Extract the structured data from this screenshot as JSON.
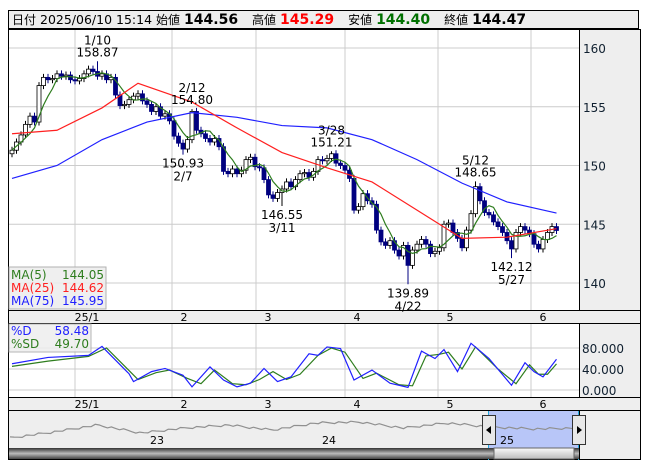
{
  "header": {
    "date_label": "日付",
    "datetime": "2025/06/10 15:14",
    "open_label": "始値",
    "open": "144.56",
    "high_label": "高値",
    "high": "145.29",
    "low_label": "安値",
    "low": "144.40",
    "close_label": "終値",
    "close": "144.47"
  },
  "colors": {
    "up_body": "#ffffff",
    "down_body": "#000080",
    "ma5": "#2e7d1e",
    "ma25": "#ff2020",
    "ma75": "#2020ff",
    "stoch_d": "#2020ff",
    "stoch_sd": "#2e7d1e",
    "high_text": "#ff0000",
    "low_text": "#007000",
    "selection": "#b8c6f8"
  },
  "chart_data": [
    {
      "type": "candlestick",
      "yticks": [
        "160",
        "155",
        "150",
        "145",
        "140"
      ],
      "ylim": [
        138,
        162
      ],
      "month_labels": [
        "25/1",
        "2",
        "3",
        "4",
        "5",
        "6"
      ],
      "first_open": 151.0,
      "close": [
        151.3,
        152.0,
        152.6,
        153.5,
        154.2,
        153.7,
        156.8,
        157.5,
        157.3,
        157.4,
        157.8,
        157.6,
        157.7,
        157.3,
        157.2,
        157.4,
        157.8,
        158.2,
        158.0,
        157.6,
        157.8,
        157.3,
        157.5,
        156.0,
        155.1,
        155.2,
        155.6,
        155.9,
        156.1,
        155.5,
        155.2,
        154.6,
        155.0,
        154.2,
        154.4,
        153.8,
        152.5,
        151.9,
        151.4,
        152.2,
        154.6,
        153.0,
        152.7,
        152.3,
        152.0,
        152.3,
        151.6,
        149.5,
        149.3,
        149.7,
        149.3,
        149.6,
        150.5,
        150.7,
        149.9,
        149.8,
        148.8,
        147.5,
        147.2,
        147.7,
        148.0,
        148.6,
        148.2,
        148.8,
        149.3,
        149.4,
        149.0,
        149.5,
        150.5,
        150.4,
        150.6,
        151.0,
        150.2,
        150.0,
        149.6,
        148.9,
        146.2,
        146.5,
        147.6,
        147.0,
        146.7,
        144.5,
        143.5,
        143.2,
        143.6,
        142.8,
        142.3,
        143.2,
        141.5,
        142.8,
        143.3,
        143.7,
        143.3,
        142.5,
        142.7,
        143.0,
        145.0,
        145.1,
        144.3,
        143.8,
        143.0,
        144.5,
        145.9,
        148.2,
        147.0,
        146.0,
        145.8,
        145.2,
        144.8,
        144.3,
        143.6,
        142.9,
        144.3,
        144.8,
        144.5,
        144.2,
        143.3,
        142.9,
        143.7,
        144.3,
        144.8,
        144.47
      ],
      "annotations": [
        {
          "date": "1/10",
          "value": "158.87",
          "index": 19,
          "position": "above"
        },
        {
          "date": "2/12",
          "value": "154.80",
          "index": 40,
          "position": "above"
        },
        {
          "date": "2/7",
          "value": "150.93",
          "index": 38,
          "position": "below"
        },
        {
          "date": "3/11",
          "value": "146.55",
          "index": 60,
          "position": "below"
        },
        {
          "date": "3/28",
          "value": "151.21",
          "index": 71,
          "position": "above"
        },
        {
          "date": "4/22",
          "value": "139.89",
          "index": 88,
          "position": "below"
        },
        {
          "date": "5/12",
          "value": "148.65",
          "index": 103,
          "position": "above"
        },
        {
          "date": "5/27",
          "value": "142.12",
          "index": 111,
          "position": "below"
        }
      ],
      "ma25": [
        [
          0,
          152.7
        ],
        [
          10,
          153.0
        ],
        [
          20,
          154.9
        ],
        [
          28,
          157.0
        ],
        [
          40,
          155.4
        ],
        [
          50,
          153.2
        ],
        [
          60,
          151.1
        ],
        [
          70,
          149.8
        ],
        [
          80,
          148.6
        ],
        [
          90,
          146.2
        ],
        [
          100,
          143.8
        ],
        [
          110,
          143.9
        ],
        [
          121,
          144.62
        ]
      ],
      "ma75": [
        [
          0,
          148.9
        ],
        [
          10,
          150.0
        ],
        [
          20,
          152.2
        ],
        [
          30,
          153.7
        ],
        [
          40,
          154.5
        ],
        [
          50,
          154.1
        ],
        [
          60,
          153.4
        ],
        [
          70,
          153.2
        ],
        [
          80,
          152.2
        ],
        [
          90,
          150.5
        ],
        [
          100,
          148.5
        ],
        [
          110,
          146.9
        ],
        [
          121,
          145.95
        ]
      ],
      "legend": [
        {
          "name": "MA(5)",
          "value": "144.05"
        },
        {
          "name": "MA(25)",
          "value": "144.62"
        },
        {
          "name": "MA(75)",
          "value": "145.95"
        }
      ]
    },
    {
      "type": "line",
      "yticks": [
        "80.000",
        "40.000",
        "0.000"
      ],
      "ylim": [
        0,
        100
      ],
      "legend": [
        {
          "name": "%D",
          "value": "58.48"
        },
        {
          "name": "%SD",
          "value": "49.70"
        }
      ],
      "series": [
        {
          "name": "%D",
          "points": [
            [
              0,
              50
            ],
            [
              8,
              62
            ],
            [
              17,
              66
            ],
            [
              20,
              83
            ],
            [
              26,
              31
            ],
            [
              27,
              16
            ],
            [
              31,
              35
            ],
            [
              34,
              41
            ],
            [
              38,
              28
            ],
            [
              40,
              6
            ],
            [
              44,
              44
            ],
            [
              47,
              19
            ],
            [
              50,
              6
            ],
            [
              53,
              13
            ],
            [
              56,
              41
            ],
            [
              59,
              16
            ],
            [
              62,
              25
            ],
            [
              66,
              69
            ],
            [
              68,
              66
            ],
            [
              70,
              82
            ],
            [
              73,
              79
            ],
            [
              76,
              19
            ],
            [
              80,
              38
            ],
            [
              84,
              13
            ],
            [
              88,
              5
            ],
            [
              91,
              74
            ],
            [
              94,
              60
            ],
            [
              96,
              77
            ],
            [
              99,
              35
            ],
            [
              102,
              89
            ],
            [
              106,
              60
            ],
            [
              111,
              9
            ],
            [
              114,
              52
            ],
            [
              116,
              35
            ],
            [
              118,
              25
            ],
            [
              121,
              58.48
            ]
          ]
        },
        {
          "name": "%SD",
          "points": [
            [
              0,
              45
            ],
            [
              8,
              55
            ],
            [
              17,
              64
            ],
            [
              21,
              80
            ],
            [
              28,
              20
            ],
            [
              32,
              33
            ],
            [
              35,
              38
            ],
            [
              39,
              22
            ],
            [
              42,
              12
            ],
            [
              45,
              38
            ],
            [
              49,
              12
            ],
            [
              52,
              10
            ],
            [
              55,
              20
            ],
            [
              58,
              35
            ],
            [
              61,
              20
            ],
            [
              64,
              30
            ],
            [
              68,
              66
            ],
            [
              71,
              80
            ],
            [
              74,
              72
            ],
            [
              78,
              22
            ],
            [
              81,
              32
            ],
            [
              86,
              10
            ],
            [
              89,
              8
            ],
            [
              92,
              65
            ],
            [
              95,
              68
            ],
            [
              97,
              72
            ],
            [
              100,
              40
            ],
            [
              103,
              82
            ],
            [
              108,
              40
            ],
            [
              112,
              12
            ],
            [
              115,
              48
            ],
            [
              117,
              30
            ],
            [
              119,
              30
            ],
            [
              121,
              49.7
            ]
          ]
        }
      ],
      "month_labels": [
        "25/1",
        "2",
        "3",
        "4",
        "5",
        "6"
      ]
    }
  ],
  "navigator": {
    "year_labels": [
      "23",
      "24",
      "25"
    ],
    "overview": [
      125.5,
      136.4,
      149,
      134.5,
      143.6,
      149,
      140,
      152.7,
      154.5,
      143.6,
      152.7,
      145.5,
      141.8,
      143.6
    ]
  }
}
